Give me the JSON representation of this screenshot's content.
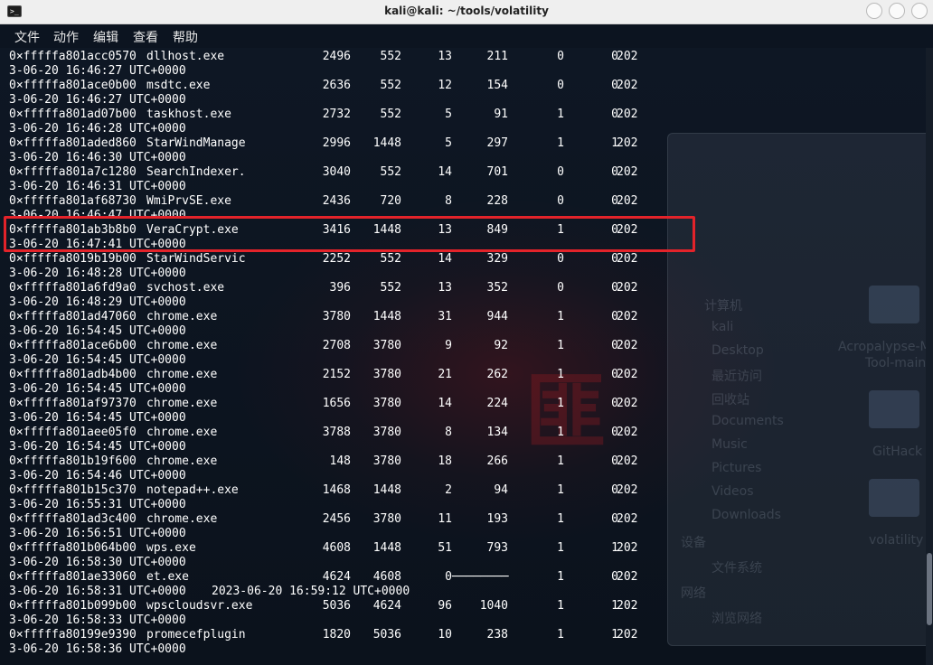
{
  "window": {
    "title": "kali@kali: ~/tools/volatility",
    "app_icon": "terminal-icon"
  },
  "menu": [
    "文件",
    "动作",
    "编辑",
    "查看",
    "帮助"
  ],
  "rows": [
    {
      "offset": "0×fffffa801acc0570",
      "name": "dllhost.exe",
      "pid": "2496",
      "ppid": "552",
      "thds": "13",
      "hnds": "211",
      "sess": "0",
      "wow64": "0",
      "start_cut": "202",
      "start_tail": "3-06-20 16:46:27 UTC+0000",
      "exit": ""
    },
    {
      "offset": "0×fffffa801ace0b00",
      "name": "msdtc.exe",
      "pid": "2636",
      "ppid": "552",
      "thds": "12",
      "hnds": "154",
      "sess": "0",
      "wow64": "0",
      "start_cut": "202",
      "start_tail": "3-06-20 16:46:27 UTC+0000",
      "exit": ""
    },
    {
      "offset": "0×fffffa801ad07b00",
      "name": "taskhost.exe",
      "pid": "2732",
      "ppid": "552",
      "thds": "5",
      "hnds": "91",
      "sess": "1",
      "wow64": "0",
      "start_cut": "202",
      "start_tail": "3-06-20 16:46:28 UTC+0000",
      "exit": ""
    },
    {
      "offset": "0×fffffa801aded860",
      "name": "StarWindManage",
      "pid": "2996",
      "ppid": "1448",
      "thds": "5",
      "hnds": "297",
      "sess": "1",
      "wow64": "1",
      "start_cut": "202",
      "start_tail": "3-06-20 16:46:30 UTC+0000",
      "exit": ""
    },
    {
      "offset": "0×fffffa801a7c1280",
      "name": "SearchIndexer.",
      "pid": "3040",
      "ppid": "552",
      "thds": "14",
      "hnds": "701",
      "sess": "0",
      "wow64": "0",
      "start_cut": "202",
      "start_tail": "3-06-20 16:46:31 UTC+0000",
      "exit": ""
    },
    {
      "offset": "0×fffffa801af68730",
      "name": "WmiPrvSE.exe",
      "pid": "2436",
      "ppid": "720",
      "thds": "8",
      "hnds": "228",
      "sess": "0",
      "wow64": "0",
      "start_cut": "202",
      "start_tail": "3-06-20 16:46:47 UTC+0000",
      "exit": ""
    },
    {
      "offset": "0×fffffa801ab3b8b0",
      "name": "VeraCrypt.exe",
      "pid": "3416",
      "ppid": "1448",
      "thds": "13",
      "hnds": "849",
      "sess": "1",
      "wow64": "0",
      "start_cut": "202",
      "start_tail": "3-06-20 16:47:41 UTC+0000",
      "exit": "",
      "highlighted": true
    },
    {
      "offset": "0×fffffa8019b19b00",
      "name": "StarWindServic",
      "pid": "2252",
      "ppid": "552",
      "thds": "14",
      "hnds": "329",
      "sess": "0",
      "wow64": "0",
      "start_cut": "202",
      "start_tail": "3-06-20 16:48:28 UTC+0000",
      "exit": ""
    },
    {
      "offset": "0×fffffa801a6fd9a0",
      "name": "svchost.exe",
      "pid": "396",
      "ppid": "552",
      "thds": "13",
      "hnds": "352",
      "sess": "0",
      "wow64": "0",
      "start_cut": "202",
      "start_tail": "3-06-20 16:48:29 UTC+0000",
      "exit": ""
    },
    {
      "offset": "0×fffffa801ad47060",
      "name": "chrome.exe",
      "pid": "3780",
      "ppid": "1448",
      "thds": "31",
      "hnds": "944",
      "sess": "1",
      "wow64": "0",
      "start_cut": "202",
      "start_tail": "3-06-20 16:54:45 UTC+0000",
      "exit": ""
    },
    {
      "offset": "0×fffffa801ace6b00",
      "name": "chrome.exe",
      "pid": "2708",
      "ppid": "3780",
      "thds": "9",
      "hnds": "92",
      "sess": "1",
      "wow64": "0",
      "start_cut": "202",
      "start_tail": "3-06-20 16:54:45 UTC+0000",
      "exit": ""
    },
    {
      "offset": "0×fffffa801adb4b00",
      "name": "chrome.exe",
      "pid": "2152",
      "ppid": "3780",
      "thds": "21",
      "hnds": "262",
      "sess": "1",
      "wow64": "0",
      "start_cut": "202",
      "start_tail": "3-06-20 16:54:45 UTC+0000",
      "exit": ""
    },
    {
      "offset": "0×fffffa801af97370",
      "name": "chrome.exe",
      "pid": "1656",
      "ppid": "3780",
      "thds": "14",
      "hnds": "224",
      "sess": "1",
      "wow64": "0",
      "start_cut": "202",
      "start_tail": "3-06-20 16:54:45 UTC+0000",
      "exit": ""
    },
    {
      "offset": "0×fffffa801aee05f0",
      "name": "chrome.exe",
      "pid": "3788",
      "ppid": "3780",
      "thds": "8",
      "hnds": "134",
      "sess": "1",
      "wow64": "0",
      "start_cut": "202",
      "start_tail": "3-06-20 16:54:45 UTC+0000",
      "exit": ""
    },
    {
      "offset": "0×fffffa801b19f600",
      "name": "chrome.exe",
      "pid": "148",
      "ppid": "3780",
      "thds": "18",
      "hnds": "266",
      "sess": "1",
      "wow64": "0",
      "start_cut": "202",
      "start_tail": "3-06-20 16:54:46 UTC+0000",
      "exit": ""
    },
    {
      "offset": "0×fffffa801b15c370",
      "name": "notepad++.exe",
      "pid": "1468",
      "ppid": "1448",
      "thds": "2",
      "hnds": "94",
      "sess": "1",
      "wow64": "0",
      "start_cut": "202",
      "start_tail": "3-06-20 16:55:31 UTC+0000",
      "exit": ""
    },
    {
      "offset": "0×fffffa801ad3c400",
      "name": "chrome.exe",
      "pid": "2456",
      "ppid": "3780",
      "thds": "11",
      "hnds": "193",
      "sess": "1",
      "wow64": "0",
      "start_cut": "202",
      "start_tail": "3-06-20 16:56:51 UTC+0000",
      "exit": ""
    },
    {
      "offset": "0×fffffa801b064b00",
      "name": "wps.exe",
      "pid": "4608",
      "ppid": "1448",
      "thds": "51",
      "hnds": "793",
      "sess": "1",
      "wow64": "1",
      "start_cut": "202",
      "start_tail": "3-06-20 16:58:30 UTC+0000",
      "exit": ""
    },
    {
      "offset": "0×fffffa801ae33060",
      "name": "et.exe",
      "pid": "4624",
      "ppid": "4608",
      "thds": "0",
      "hnds": "————————",
      "sess": "1",
      "wow64": "0",
      "start_cut": "202",
      "start_tail": "3-06-20 16:58:31 UTC+0000",
      "exit": "2023-06-20 16:59:12 UTC+0000"
    },
    {
      "offset": "0×fffffa801b099b00",
      "name": "wpscloudsvr.exe",
      "pid": "5036",
      "ppid": "4624",
      "thds": "96",
      "hnds": "1040",
      "sess": "1",
      "wow64": "1",
      "start_cut": "202",
      "start_tail": "3-06-20 16:58:33 UTC+0000",
      "exit": ""
    },
    {
      "offset": "0×fffffa80199e9390",
      "name": "promecefplugin",
      "pid": "1820",
      "ppid": "5036",
      "thds": "10",
      "hnds": "238",
      "sess": "1",
      "wow64": "1",
      "start_cut": "202",
      "start_tail": "3-06-20 16:58:36 UTC+0000",
      "exit": ""
    }
  ],
  "background_file_manager": {
    "sidebar": [
      "计算机",
      "kali",
      "Desktop",
      "最近访问",
      "回收站",
      "Documents",
      "Music",
      "Pictures",
      "Videos",
      "Downloads"
    ],
    "section_devices": "设备",
    "device_item": "文件系统",
    "section_network": "网络",
    "network_item": "浏览网络",
    "folders": [
      "Acropalypse-M",
      "Tool-main",
      "GitHack",
      "volatility"
    ]
  }
}
